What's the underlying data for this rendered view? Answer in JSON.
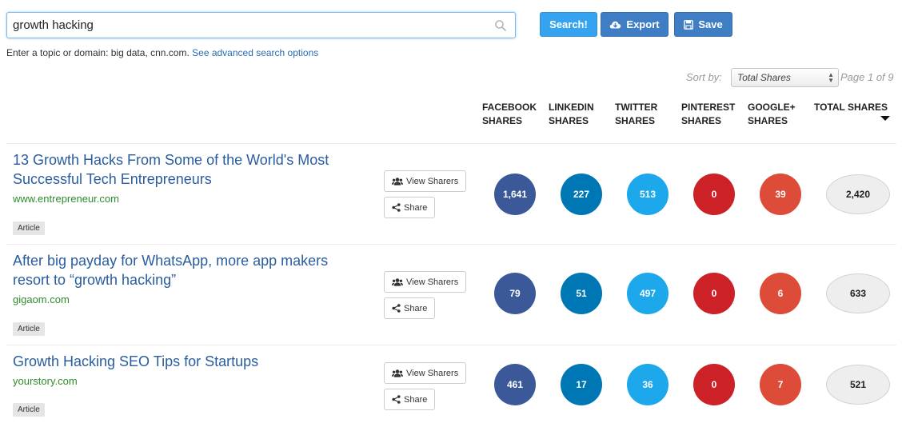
{
  "search": {
    "query": "growth hacking",
    "placeholder": "",
    "hint_text": "Enter a topic or domain: big data, cnn.com.",
    "advanced_link": "See advanced search options"
  },
  "toolbar": {
    "search_label": "Search!",
    "export_label": "Export",
    "save_label": "Save"
  },
  "sort": {
    "label": "Sort by:",
    "selected": "Total Shares",
    "page_indicator": "Page 1 of 9"
  },
  "columns": {
    "facebook": [
      "FACEBOOK",
      "SHARES"
    ],
    "linkedin": [
      "LINKEDIN",
      "SHARES"
    ],
    "twitter": [
      "TWITTER",
      "SHARES"
    ],
    "pinterest": [
      "PINTEREST",
      "SHARES"
    ],
    "googleplus": [
      "GOOGLE+",
      "SHARES"
    ],
    "total": [
      "TOTAL SHARES"
    ]
  },
  "actions": {
    "view_sharers": "View Sharers",
    "share": "Share"
  },
  "colors": {
    "facebook": "#3b5998",
    "linkedin": "#0077b5",
    "twitter": "#1da8ec",
    "pinterest": "#cc2127",
    "googleplus": "#dd4b39",
    "link": "#2a5d9f",
    "domain": "#2e8b2e"
  },
  "results": [
    {
      "title": "13 Growth Hacks From Some of the World's Most Successful Tech Entrepreneurs",
      "domain": "www.entrepreneur.com",
      "type": "Article",
      "facebook": "1,641",
      "linkedin": "227",
      "twitter": "513",
      "pinterest": "0",
      "googleplus": "39",
      "total": "2,420"
    },
    {
      "title": "After big payday for WhatsApp, more app makers resort to “growth hacking”",
      "domain": "gigaom.com",
      "type": "Article",
      "facebook": "79",
      "linkedin": "51",
      "twitter": "497",
      "pinterest": "0",
      "googleplus": "6",
      "total": "633"
    },
    {
      "title": "Growth Hacking SEO Tips for Startups",
      "domain": "yourstory.com",
      "type": "Article",
      "facebook": "461",
      "linkedin": "17",
      "twitter": "36",
      "pinterest": "0",
      "googleplus": "7",
      "total": "521"
    }
  ]
}
